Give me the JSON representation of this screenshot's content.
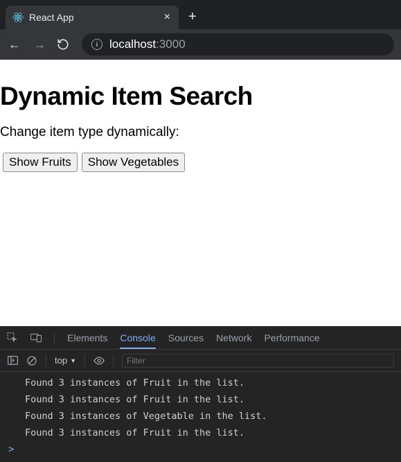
{
  "browser": {
    "tab_title": "React App",
    "newtab_glyph": "+",
    "close_glyph": "×",
    "nav": {
      "back": "←",
      "forward": "→",
      "reload": "⟳"
    },
    "url_host": "localhost",
    "url_port": ":3000"
  },
  "page": {
    "heading": "Dynamic Item Search",
    "subtitle": "Change item type dynamically:",
    "buttons": {
      "fruits": "Show Fruits",
      "vegetables": "Show Vegetables"
    }
  },
  "devtools": {
    "tabs": {
      "elements": "Elements",
      "console": "Console",
      "sources": "Sources",
      "network": "Network",
      "performance": "Performance"
    },
    "context_label": "top",
    "context_caret": "▼",
    "filter_placeholder": "Filter",
    "prompt": ">",
    "log_lines": [
      "Found 3 instances of Fruit in the list.",
      "Found 3 instances of Fruit in the list.",
      "Found 3 instances of Vegetable in the list.",
      "Found 3 instances of Fruit in the list."
    ]
  }
}
